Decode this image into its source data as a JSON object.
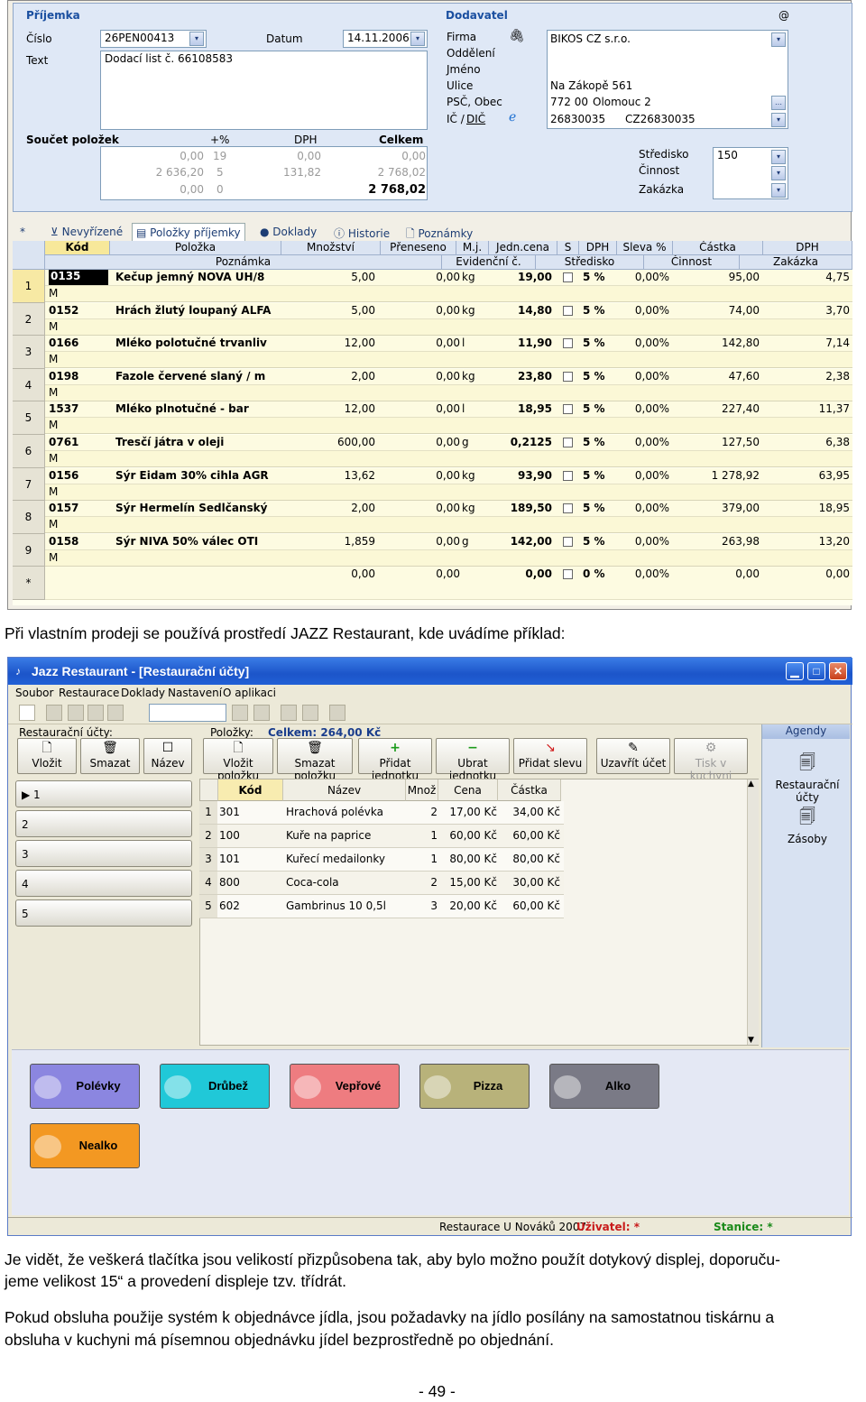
{
  "shot1": {
    "sections": {
      "prijemka": "Příjemka",
      "dodavatel": "Dodavatel",
      "at": "@"
    },
    "fields": {
      "cislo_label": "Číslo",
      "cislo_value": "26PEN00413",
      "datum_label": "Datum",
      "datum_value": "14.11.2006",
      "text_label": "Text",
      "text_value": "Dodací list č. 66108583",
      "firma_label": "Firma",
      "oddeleni_label": "Oddělení",
      "jmeno_label": "Jméno",
      "ulice_label": "Ulice",
      "psc_label": "PSČ, Obec",
      "ic_label": "IČ /",
      "dic_label": "DIČ",
      "firma_value": "BIKOS CZ s.r.o.",
      "ulice_value": "Na Zákopě 561",
      "psc_value": "772 00",
      "obec_value": "Olomouc 2",
      "ic_value": "26830035",
      "dic_value": "CZ26830035",
      "stredisko_label": "Středisko",
      "stredisko_value": "150",
      "cinnost_label": "Činnost",
      "zakazka_label": "Zakázka"
    },
    "soucet": {
      "title": "Součet položek",
      "headers": [
        "+%",
        "DPH",
        "Celkem"
      ],
      "rows": [
        [
          "0,00",
          "19",
          "0,00",
          "0,00"
        ],
        [
          "2 636,20",
          "5",
          "131,82",
          "2 768,02"
        ],
        [
          "0,00",
          "0",
          "",
          ""
        ]
      ],
      "total": "2 768,02"
    },
    "tabs": [
      "*",
      "Nevyřízené",
      "Položky příjemky",
      "Doklady",
      "Historie",
      "Poznámky"
    ],
    "grid_headers_1": [
      "Kód",
      "Položka",
      "Množství",
      "Přeneseno",
      "M.j.",
      "Jedn.cena",
      "S",
      "DPH",
      "Sleva %",
      "Částka",
      "DPH"
    ],
    "grid_headers_2": [
      "Poznámka",
      "Evidenční č.",
      "Středisko",
      "Činnost",
      "Zakázka"
    ],
    "rows": [
      {
        "n": "1",
        "kod": "0135",
        "nazev": "Kečup jemný NOVA UH/8",
        "mnoz": "5,00",
        "pren": "0,00",
        "mj": "kg",
        "cena": "19,00",
        "dph": "5 %",
        "sleva": "0,00%",
        "castka": "95,00",
        "dphc": "4,75",
        "pozn": "M"
      },
      {
        "n": "2",
        "kod": "0152",
        "nazev": "Hrách žlutý loupaný ALFA",
        "mnoz": "5,00",
        "pren": "0,00",
        "mj": "kg",
        "cena": "14,80",
        "dph": "5 %",
        "sleva": "0,00%",
        "castka": "74,00",
        "dphc": "3,70",
        "pozn": "M"
      },
      {
        "n": "3",
        "kod": "0166",
        "nazev": "Mléko polotučné trvanliv",
        "mnoz": "12,00",
        "pren": "0,00",
        "mj": "l",
        "cena": "11,90",
        "dph": "5 %",
        "sleva": "0,00%",
        "castka": "142,80",
        "dphc": "7,14",
        "pozn": "M"
      },
      {
        "n": "4",
        "kod": "0198",
        "nazev": "Fazole červené slaný / m",
        "mnoz": "2,00",
        "pren": "0,00",
        "mj": "kg",
        "cena": "23,80",
        "dph": "5 %",
        "sleva": "0,00%",
        "castka": "47,60",
        "dphc": "2,38",
        "pozn": "M"
      },
      {
        "n": "5",
        "kod": "1537",
        "nazev": "Mléko plnotučné - bar",
        "mnoz": "12,00",
        "pren": "0,00",
        "mj": "l",
        "cena": "18,95",
        "dph": "5 %",
        "sleva": "0,00%",
        "castka": "227,40",
        "dphc": "11,37",
        "pozn": "M"
      },
      {
        "n": "6",
        "kod": "0761",
        "nazev": "Tresčí játra v oleji",
        "mnoz": "600,00",
        "pren": "0,00",
        "mj": "g",
        "cena": "0,2125",
        "dph": "5 %",
        "sleva": "0,00%",
        "castka": "127,50",
        "dphc": "6,38",
        "pozn": "M"
      },
      {
        "n": "7",
        "kod": "0156",
        "nazev": "Sýr Eidam 30% cihla AGR",
        "mnoz": "13,62",
        "pren": "0,00",
        "mj": "kg",
        "cena": "93,90",
        "dph": "5 %",
        "sleva": "0,00%",
        "castka": "1 278,92",
        "dphc": "63,95",
        "pozn": "M"
      },
      {
        "n": "8",
        "kod": "0157",
        "nazev": "Sýr Hermelín Sedlčanský",
        "mnoz": "2,00",
        "pren": "0,00",
        "mj": "kg",
        "cena": "189,50",
        "dph": "5 %",
        "sleva": "0,00%",
        "castka": "379,00",
        "dphc": "18,95",
        "pozn": "M"
      },
      {
        "n": "9",
        "kod": "0158",
        "nazev": "Sýr NIVA 50% válec OTI",
        "mnoz": "1,859",
        "pren": "0,00",
        "mj": "g",
        "cena": "142,00",
        "dph": "5 %",
        "sleva": "0,00%",
        "castka": "263,98",
        "dphc": "13,20",
        "pozn": "M"
      }
    ],
    "new_row": {
      "n": "*",
      "mnoz": "0,00",
      "pren": "0,00",
      "cena": "0,00",
      "dph": "0 %",
      "sleva": "0,00%",
      "castka": "0,00",
      "dphc": "0,00"
    }
  },
  "para1": "Při vlastním prodeji se používá prostředí JAZZ Restaurant, kde uvádíme příklad:",
  "shot2": {
    "title": "Jazz Restaurant - [Restaurační účty]",
    "menu": [
      "Soubor",
      "Restaurace",
      "Doklady",
      "Nastavení",
      "O aplikaci"
    ],
    "ucty_label": "Restaurační účty:",
    "polozky_label": "Položky:",
    "celkem": "Celkem: 264,00 Kč",
    "agendy_label": "Agendy",
    "left_buttons": [
      "Vložit",
      "Smazat",
      "Název"
    ],
    "mid_buttons": [
      "Vložit položku",
      "Smazat položku",
      "Přidat jednotku",
      "Ubrat jednotku",
      "Přidat slevu",
      "Uzavřít účet",
      "Tisk v kuchyni"
    ],
    "accounts": [
      "1",
      "2",
      "3",
      "4",
      "5"
    ],
    "table_headers": [
      "Kód",
      "Název",
      "Množ",
      "Cena",
      "Částka"
    ],
    "items": [
      {
        "n": "1",
        "kod": "301",
        "nazev": "Hrachová polévka",
        "mnoz": "2",
        "cena": "17,00 Kč",
        "castka": "34,00 Kč"
      },
      {
        "n": "2",
        "kod": "100",
        "nazev": "Kuře na paprice",
        "mnoz": "1",
        "cena": "60,00 Kč",
        "castka": "60,00 Kč"
      },
      {
        "n": "3",
        "kod": "101",
        "nazev": "Kuřecí medailonky",
        "mnoz": "1",
        "cena": "80,00 Kč",
        "castka": "80,00 Kč"
      },
      {
        "n": "4",
        "kod": "800",
        "nazev": "Coca-cola",
        "mnoz": "2",
        "cena": "15,00 Kč",
        "castka": "30,00 Kč"
      },
      {
        "n": "5",
        "kod": "602",
        "nazev": "Gambrinus 10 0,5l",
        "mnoz": "3",
        "cena": "20,00 Kč",
        "castka": "60,00 Kč"
      }
    ],
    "agendy": [
      "Restaurační účty",
      "Zásoby"
    ],
    "categories": [
      {
        "label": "Polévky",
        "color": "#8b86e0"
      },
      {
        "label": "Drůbež",
        "color": "#20c8d8"
      },
      {
        "label": "Vepřové",
        "color": "#ee7c80"
      },
      {
        "label": "Pizza",
        "color": "#b8b27a"
      },
      {
        "label": "Alko",
        "color": "#7a7a86"
      },
      {
        "label": "Nealko",
        "color": "#f39822"
      }
    ],
    "status": {
      "restaurace": "Restaurace U Nováků 2007",
      "uzivatel": "Uživatel: *",
      "stanice": "Stanice: *"
    }
  },
  "para2": "Je vidět, že veškerá tlačítka jsou velikostí přizpůsobena tak, aby bylo možno použít dotykový displej, doporuču-",
  "para3": "jeme velikost 15“ a provedení displeje tzv. třídrát.",
  "para4": "Pokud obsluha použije systém k objednávce jídla, jsou požadavky na jídlo posílány na samostatnou tiskárnu a",
  "para5": "obsluha v kuchyni má písemnou objednávku jídel bezprostředně po objednání.",
  "page_number": "- 49 -"
}
